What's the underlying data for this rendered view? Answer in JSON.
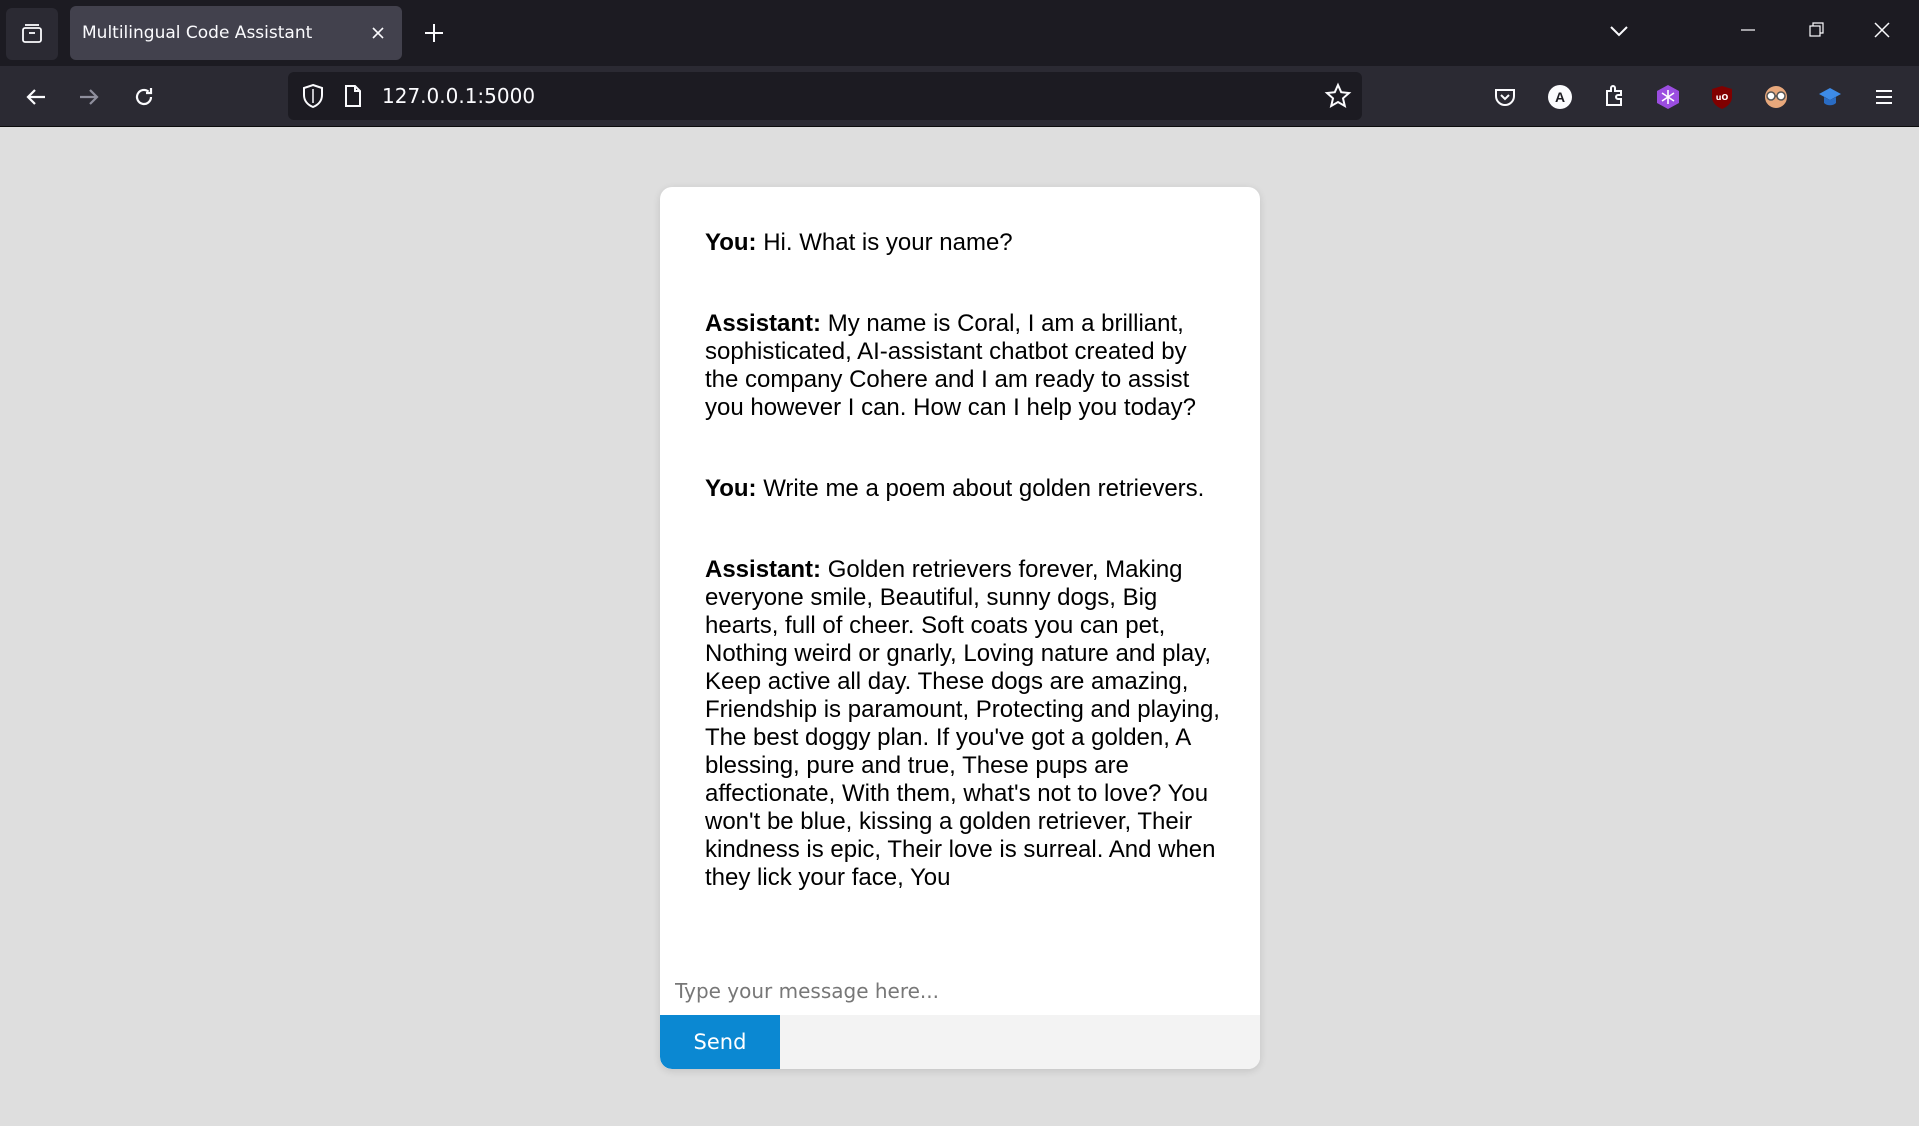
{
  "browser": {
    "tab_title": "Multilingual Code Assistant",
    "url": "127.0.0.1:5000",
    "extension_badge_letter": "A",
    "ublock_label": "uo"
  },
  "chat": {
    "messages": [
      {
        "speaker": "You:",
        "text": " Hi. What is your name?"
      },
      {
        "speaker": "Assistant:",
        "text": " My name is Coral, I am a brilliant, sophisticated, AI-assistant chatbot created by the company Cohere and I am ready to assist you however I can. How can I help you today?"
      },
      {
        "speaker": "You:",
        "text": " Write me a poem about golden retrievers."
      },
      {
        "speaker": "Assistant:",
        "text": " Golden retrievers forever, Making everyone smile, Beautiful, sunny dogs, Big hearts, full of cheer. Soft coats you can pet, Nothing weird or gnarly, Loving nature and play, Keep active all day. These dogs are amazing, Friendship is paramount, Protecting and playing, The best doggy plan. If you've got a golden, A blessing, pure and true, These pups are affectionate, With them, what's not to love? You won't be blue, kissing a golden retriever, Their kindness is epic, Their love is surreal. And when they lick your face, You"
      }
    ],
    "input_placeholder": "Type your message here...",
    "input_value": "",
    "send_label": "Send"
  },
  "colors": {
    "page_bg": "#dedede",
    "send_button": "#0b88d2",
    "chrome_dark": "#1c1b22",
    "toolbar": "#2b2a33"
  },
  "icons": [
    "tab-overview-icon",
    "close-icon",
    "plus-icon",
    "chevron-down-icon",
    "minimize-icon",
    "restore-icon",
    "window-close-icon",
    "back-icon",
    "forward-icon",
    "reload-icon",
    "shield-icon",
    "page-icon",
    "star-icon",
    "pocket-icon",
    "account-icon",
    "extensions-icon",
    "snowflake-extension-icon",
    "ublock-icon",
    "glasses-extension-icon",
    "graduation-cap-icon",
    "menu-icon"
  ]
}
